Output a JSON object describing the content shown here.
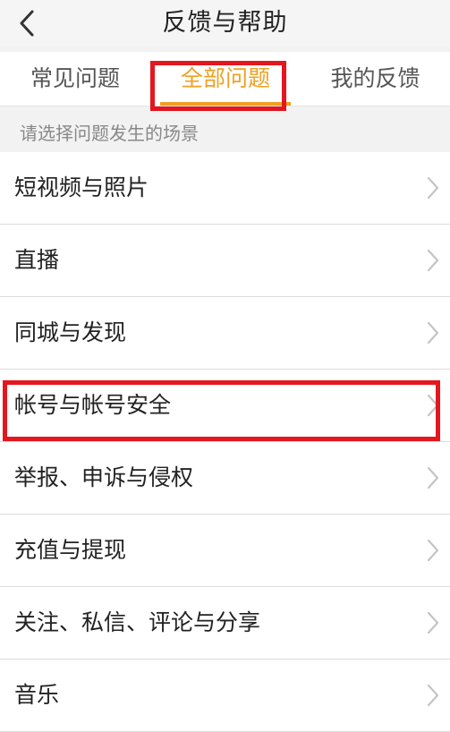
{
  "header": {
    "title": "反馈与帮助"
  },
  "tabs": [
    {
      "label": "常见问题",
      "active": false
    },
    {
      "label": "全部问题",
      "active": true
    },
    {
      "label": "我的反馈",
      "active": false
    }
  ],
  "section": {
    "label": "请选择问题发生的场景"
  },
  "list": {
    "items": [
      {
        "label": "短视频与照片"
      },
      {
        "label": "直播"
      },
      {
        "label": "同城与发现"
      },
      {
        "label": "帐号与帐号安全"
      },
      {
        "label": "举报、申诉与侵权"
      },
      {
        "label": "充值与提现"
      },
      {
        "label": "关注、私信、评论与分享"
      },
      {
        "label": "音乐"
      }
    ]
  },
  "colors": {
    "accent": "#f0a020",
    "highlight": "#e4161e",
    "text": "#222222",
    "muted": "#888888"
  },
  "icons": {
    "back": "chevron-left-icon",
    "row_arrow": "chevron-right-icon"
  }
}
